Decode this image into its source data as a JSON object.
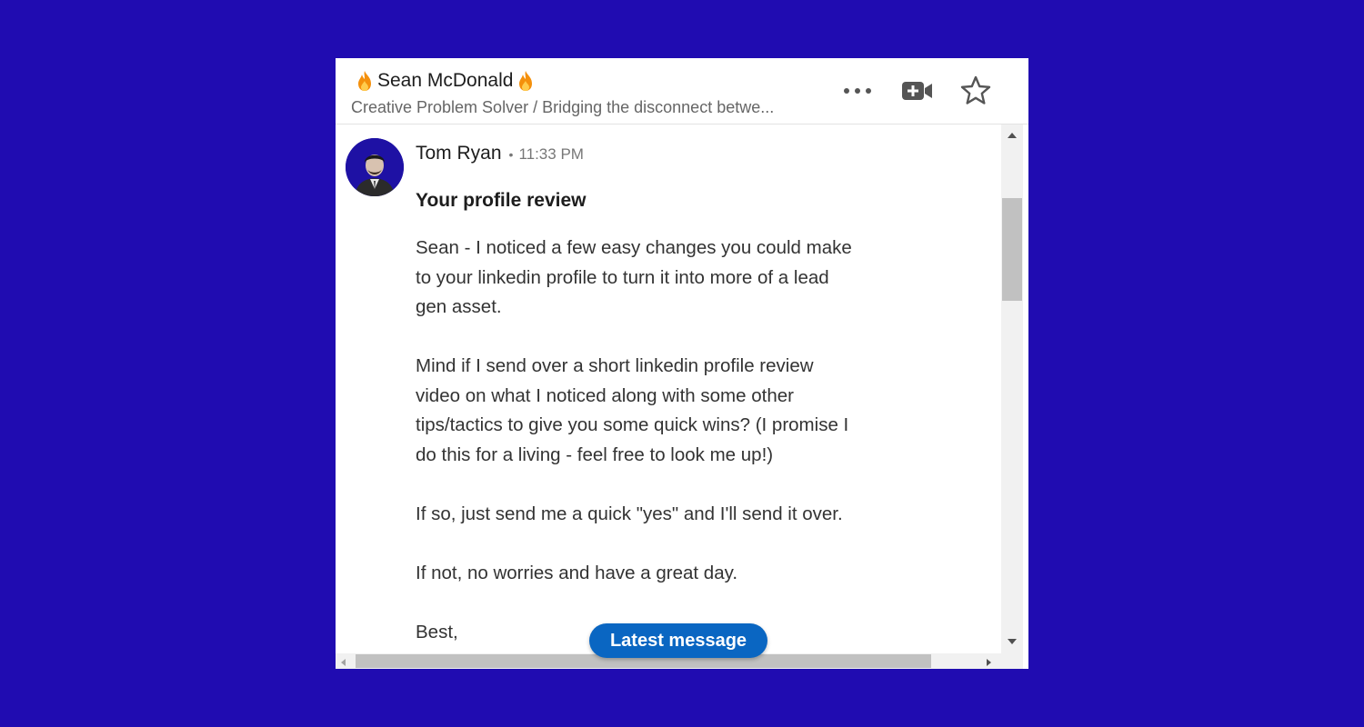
{
  "header": {
    "contact_name": "Sean McDonald",
    "name_decoration_icon": "fire-emoji",
    "headline": "Creative Problem Solver / Bridging the disconnect betwe...",
    "actions": [
      "more-options-icon",
      "video-call-icon",
      "star-icon"
    ]
  },
  "message": {
    "sender": "Tom Ryan",
    "separator": "•",
    "time": "11:33 PM",
    "subject": "Your profile review",
    "body": "Sean - I noticed a few easy changes you could make\nto your linkedin profile to turn it into more of a lead\ngen asset.\n\nMind if I send over a short linkedin profile review\nvideo on what I noticed along with some other\ntips/tactics to give you some quick wins? (I promise I\ndo this for a living - feel free to look me up!)\n\nIf so, just send me a quick \"yes\" and I'll send it over.\n\nIf not, no worries and have a great day.\n\nBest,\nT"
  },
  "latest_message_button": "Latest message",
  "colors": {
    "page_background": "#200cb1",
    "panel_background": "#ffffff",
    "button_blue": "#0a66c2",
    "avatar_background": "#1e11a4",
    "muted_text": "#666666"
  }
}
